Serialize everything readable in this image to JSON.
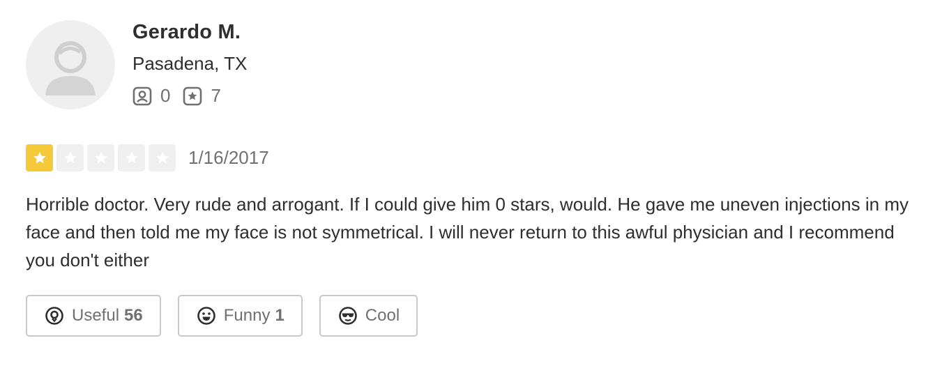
{
  "user": {
    "name": "Gerardo M.",
    "location": "Pasadena, TX",
    "friends_icon": "friends-icon",
    "friends_count": "0",
    "reviews_icon": "star-review-icon",
    "reviews_count": "7"
  },
  "review": {
    "rating": 1,
    "max_rating": 5,
    "date": "1/16/2017",
    "text": "Horrible doctor. Very rude and arrogant. If I could give him 0 stars, would. He gave me uneven injections in my face and then told me my face is not symmetrical. I will never return to this awful physician and I recommend you don't either"
  },
  "reactions": {
    "useful": {
      "label": "Useful",
      "count": "56",
      "icon": "lightbulb-icon"
    },
    "funny": {
      "label": "Funny",
      "count": "1",
      "icon": "smile-icon"
    },
    "cool": {
      "label": "Cool",
      "icon": "sunglasses-icon"
    }
  },
  "colors": {
    "star_on": "#f4c93a",
    "star_off": "#f0f0f0",
    "text": "#2d2e2f",
    "muted": "#6e7072",
    "border": "#c8c9ca"
  }
}
